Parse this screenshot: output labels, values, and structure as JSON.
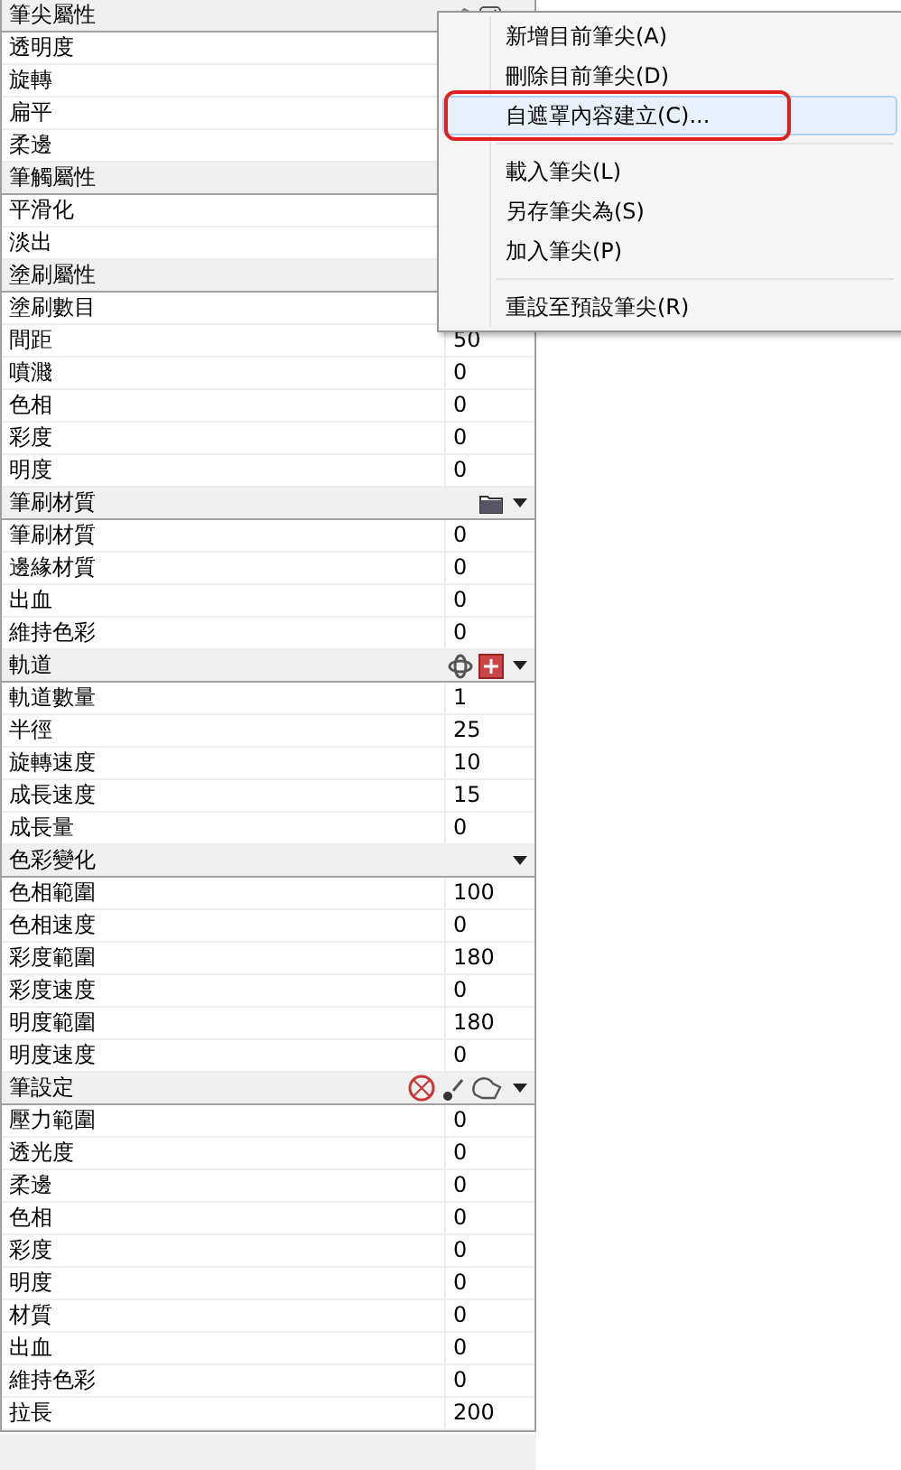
{
  "sections": [
    {
      "title": "筆尖屬性",
      "rows": [
        {
          "label": "透明度"
        },
        {
          "label": "旋轉"
        },
        {
          "label": "扁平"
        },
        {
          "label": "柔邊"
        }
      ]
    },
    {
      "title": "筆觸屬性",
      "rows": [
        {
          "label": "平滑化"
        },
        {
          "label": "淡出"
        }
      ]
    },
    {
      "title": "塗刷屬性",
      "rows": [
        {
          "label": "塗刷數目"
        },
        {
          "label": "間距",
          "value": "50"
        },
        {
          "label": "噴濺",
          "value": "0"
        },
        {
          "label": "色相",
          "value": "0"
        },
        {
          "label": "彩度",
          "value": "0"
        },
        {
          "label": "明度",
          "value": "0"
        }
      ]
    },
    {
      "title": "筆刷材質",
      "rows": [
        {
          "label": "筆刷材質",
          "value": "0"
        },
        {
          "label": "邊緣材質",
          "value": "0"
        },
        {
          "label": "出血",
          "value": "0"
        },
        {
          "label": "維持色彩",
          "value": "0"
        }
      ]
    },
    {
      "title": "軌道",
      "rows": [
        {
          "label": "軌道數量",
          "value": "1"
        },
        {
          "label": "半徑",
          "value": "25"
        },
        {
          "label": "旋轉速度",
          "value": "10"
        },
        {
          "label": "成長速度",
          "value": "15"
        },
        {
          "label": "成長量",
          "value": "0"
        }
      ]
    },
    {
      "title": "色彩變化",
      "rows": [
        {
          "label": "色相範圍",
          "value": "100"
        },
        {
          "label": "色相速度",
          "value": "0"
        },
        {
          "label": "彩度範圍",
          "value": "180"
        },
        {
          "label": "彩度速度",
          "value": "0"
        },
        {
          "label": "明度範圍",
          "value": "180"
        },
        {
          "label": "明度速度",
          "value": "0"
        }
      ]
    },
    {
      "title": "筆設定",
      "rows": [
        {
          "label": "壓力範圍",
          "value": "0"
        },
        {
          "label": "透光度",
          "value": "0"
        },
        {
          "label": "柔邊",
          "value": "0"
        },
        {
          "label": "色相",
          "value": "0"
        },
        {
          "label": "彩度",
          "value": "0"
        },
        {
          "label": "明度",
          "value": "0"
        },
        {
          "label": "材質",
          "value": "0"
        },
        {
          "label": "出血",
          "value": "0"
        },
        {
          "label": "維持色彩",
          "value": "0"
        },
        {
          "label": "拉長",
          "value": "200"
        }
      ]
    }
  ],
  "context_menu": {
    "items": [
      {
        "kind": "item",
        "label": "新增目前筆尖(A)",
        "selected": false,
        "circled": false
      },
      {
        "kind": "item",
        "label": "刪除目前筆尖(D)",
        "selected": false,
        "circled": false
      },
      {
        "kind": "item",
        "label": "自遮罩內容建立(C)...",
        "selected": true,
        "circled": true
      },
      {
        "kind": "separator"
      },
      {
        "kind": "item",
        "label": "載入筆尖(L)",
        "selected": false,
        "circled": false
      },
      {
        "kind": "item",
        "label": "另存筆尖為(S)",
        "selected": false,
        "circled": false
      },
      {
        "kind": "item",
        "label": "加入筆尖(P)",
        "selected": false,
        "circled": false
      },
      {
        "kind": "separator"
      },
      {
        "kind": "item",
        "label": "重設至預設筆尖(R)",
        "selected": false,
        "circled": false
      }
    ]
  }
}
